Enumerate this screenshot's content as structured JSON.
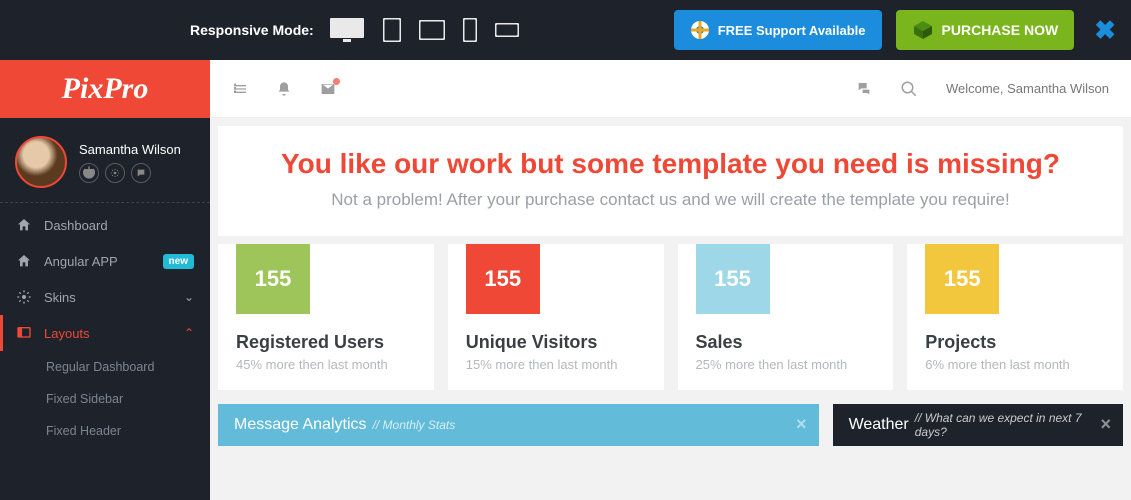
{
  "demo_bar": {
    "responsive_label": "Responsive Mode:",
    "support_label": "FREE Support Available",
    "purchase_label": "PURCHASE NOW"
  },
  "brand": "PixPro",
  "user": {
    "name": "Samantha Wilson",
    "welcome": "Welcome, Samantha Wilson"
  },
  "sidebar": {
    "items": [
      {
        "label": "Dashboard"
      },
      {
        "label": "Angular APP",
        "badge": "new"
      },
      {
        "label": "Skins"
      },
      {
        "label": "Layouts"
      }
    ],
    "layouts_children": [
      {
        "label": "Regular Dashboard"
      },
      {
        "label": "Fixed Sidebar"
      },
      {
        "label": "Fixed Header"
      }
    ]
  },
  "banner": {
    "headline": "You like our work but some template you need is missing?",
    "subhead": "Not a problem! After your purchase contact us and we will create the template you require!"
  },
  "stats": [
    {
      "value": "155",
      "title": "Registered Users",
      "sub": "45% more then last month",
      "color": "c-green"
    },
    {
      "value": "155",
      "title": "Unique Visitors",
      "sub": "15% more then last month",
      "color": "c-red"
    },
    {
      "value": "155",
      "title": "Sales",
      "sub": "25% more then last month",
      "color": "c-blue"
    },
    {
      "value": "155",
      "title": "Projects",
      "sub": "6% more then last month",
      "color": "c-yellow"
    }
  ],
  "panels": {
    "analytics": {
      "title": "Message Analytics",
      "sub": "// Monthly Stats"
    },
    "weather": {
      "title": "Weather",
      "sub": "// What can we expect in next 7 days?"
    }
  },
  "colors": {
    "accent": "#ef4836",
    "green": "#9dc55a",
    "lightblue": "#9dd7e8",
    "yellow": "#f2c73e",
    "panel_blue": "#62bbd8"
  }
}
